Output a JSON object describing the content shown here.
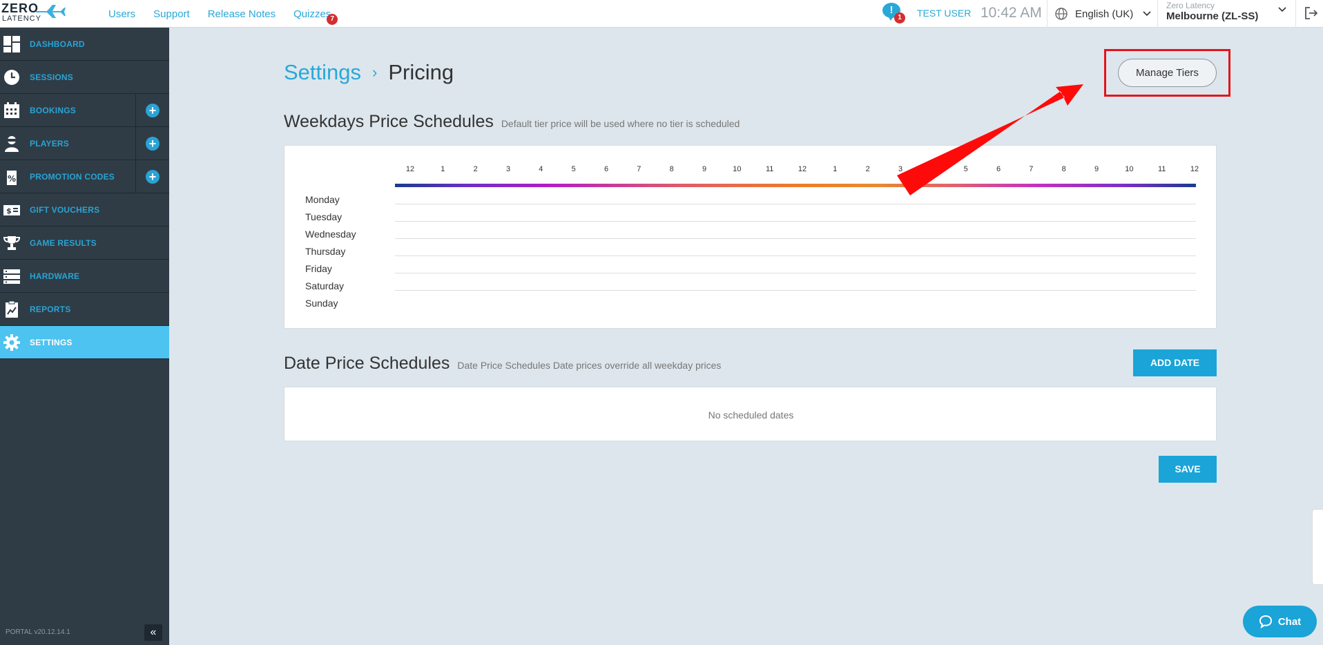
{
  "app": {
    "logo_line1": "ZERO",
    "logo_line2": "LATENCY",
    "version": "PORTAL v20.12.14.1"
  },
  "topnav": {
    "links": [
      {
        "label": "Users"
      },
      {
        "label": "Support"
      },
      {
        "label": "Release Notes"
      },
      {
        "label": "Quizzes",
        "badge": "7"
      }
    ],
    "notifications_count": "1",
    "notifications_glyph": "!",
    "user": "TEST USER",
    "time": "10:42 AM",
    "language": "English (UK)",
    "org": "Zero Latency",
    "site": "Melbourne (ZL-SS)"
  },
  "sidebar": {
    "items": [
      {
        "label": "DASHBOARD",
        "icon": "dashboard-icon"
      },
      {
        "label": "SESSIONS",
        "icon": "clock-icon"
      },
      {
        "label": "BOOKINGS",
        "icon": "calendar-icon",
        "add": true
      },
      {
        "label": "PLAYERS",
        "icon": "player-icon",
        "add": true
      },
      {
        "label": "PROMOTION CODES",
        "icon": "percent-tag-icon",
        "add": true
      },
      {
        "label": "GIFT VOUCHERS",
        "icon": "voucher-icon"
      },
      {
        "label": "GAME RESULTS",
        "icon": "trophy-icon"
      },
      {
        "label": "HARDWARE",
        "icon": "server-icon"
      },
      {
        "label": "REPORTS",
        "icon": "report-icon"
      },
      {
        "label": "SETTINGS",
        "icon": "gear-icon",
        "active": true
      }
    ],
    "add_glyph": "+",
    "collapse_glyph": "«"
  },
  "breadcrumb": {
    "parent": "Settings",
    "separator": "›",
    "current": "Pricing"
  },
  "manage_tiers_label": "Manage Tiers",
  "weekdays": {
    "title": "Weekdays Price Schedules",
    "subtitle": "Default tier price will be used where no tier is scheduled",
    "hours": [
      "12",
      "1",
      "2",
      "3",
      "4",
      "5",
      "6",
      "7",
      "8",
      "9",
      "10",
      "11",
      "12",
      "1",
      "2",
      "3",
      "4",
      "5",
      "6",
      "7",
      "8",
      "9",
      "10",
      "11",
      "12"
    ],
    "days": [
      "Monday",
      "Tuesday",
      "Wednesday",
      "Thursday",
      "Friday",
      "Saturday",
      "Sunday"
    ]
  },
  "dates": {
    "title": "Date Price Schedules",
    "subtitle": "Date Price Schedules Date prices override all weekday prices",
    "add_label": "ADD DATE",
    "empty_text": "No scheduled dates"
  },
  "save_label": "SAVE",
  "chat_label": "Chat",
  "colors": {
    "accent": "#1aa4d8",
    "sidebar_bg": "#2f3c46",
    "sidebar_active": "#4cc3f0",
    "highlight_red": "#e4141b"
  }
}
